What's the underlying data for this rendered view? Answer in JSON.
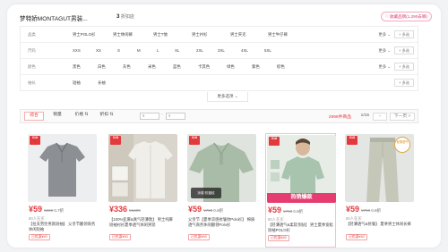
{
  "shop": {
    "name": "梦特娇MONTAGUT男装...",
    "rating_value": "3",
    "rating_suffix": "折扣店",
    "fav_label": "收藏品牌(1,290去哪)"
  },
  "filters": [
    {
      "label": "品类",
      "options": [
        "男士POLO衫",
        "男士休闲裤",
        "男士T恤",
        "男士衬衫",
        "男士夹克",
        "男士牛仔裤"
      ],
      "more": "更多 ⌄",
      "multi": "+ 多选"
    },
    {
      "label": "尺码",
      "options": [
        "XXS",
        "XS",
        "S",
        "M",
        "L",
        "XL",
        "2XL",
        "3XL",
        "4XL",
        "5XL"
      ],
      "more": "更多 ⌄",
      "multi": "+ 多选"
    },
    {
      "label": "颜色",
      "options": [
        "黑色",
        "白色",
        "灰色",
        "米色",
        "蓝色",
        "卡其色",
        "绿色",
        "紫色",
        "棕色"
      ],
      "more": "更多 ⌄",
      "multi": "+ 多选"
    },
    {
      "label": "袖长",
      "options": [
        "短袖",
        "长袖"
      ],
      "more": "",
      "multi": "+ 多选"
    }
  ],
  "more_options": "更多选项 ⌄",
  "sortbar": {
    "tabs": [
      "综合",
      "销量",
      "价格 ⇅",
      "折扣 ⇅"
    ],
    "active_tab": 0,
    "price_min_placeholder": "¥",
    "price_max_placeholder": "¥",
    "dash": "-",
    "count_value": "2999件",
    "count_suffix": "商品",
    "page": "1/15",
    "prev": "<",
    "next": "下一页 >"
  },
  "products": [
    {
      "badge": "618",
      "price": "¥59",
      "original_price": "¥299",
      "discount": "0.7折",
      "sales": "80人在买",
      "title": "【拉夫劳伦男款短袖】 父亲节翻领商务休闲短袖",
      "coupon": "已优惠¥40",
      "bg": "#eceeef",
      "garment_color": "#8c8f93"
    },
    {
      "badge": "618",
      "price": "¥336",
      "original_price": "¥1399",
      "discount": "",
      "sales": "",
      "title": "【100%亚麻&真气轻薄款】 男士纯麻短袖衬衫夏季透气休闲男装",
      "coupon": "已优惠¥40",
      "bg": "#d9d4cc",
      "garment_color": "#efeee9"
    },
    {
      "badge": "618",
      "price": "¥59",
      "original_price": "¥799",
      "discount": "0.6折",
      "sales": "",
      "title": "父亲节【夏季凉感抗皱纹Polo衫】 棉质透气商务休闲翻领Polo衫",
      "coupon": "已优惠¥40",
      "bg": "#dfe4df",
      "garment_color": "#a9bca7",
      "mini_banner": "凉感·抗皱纹"
    },
    {
      "badge": "618",
      "price": "¥59",
      "original_price": "¥799",
      "discount": "0.6折",
      "sales": "80人在买",
      "title": "【轻薄透气&柔软亲肤】 男士夏季宽松短袖POLO衫",
      "coupon": "已优惠¥40",
      "bg": "#e7ece7",
      "garment_color": "#a8c3ae",
      "hot_banner": "热销爆款"
    },
    {
      "badge": "618",
      "price": "¥59",
      "original_price": "¥799",
      "discount": "0.6折",
      "sales": "80人在买",
      "title": "【轻薄透气&抗皱】 夏季男士休闲长裤",
      "coupon": "已优惠¥40",
      "bg": "#e4e6e3",
      "garment_color": "#c5c8b9",
      "badge_circle": "轻薄透气"
    }
  ]
}
